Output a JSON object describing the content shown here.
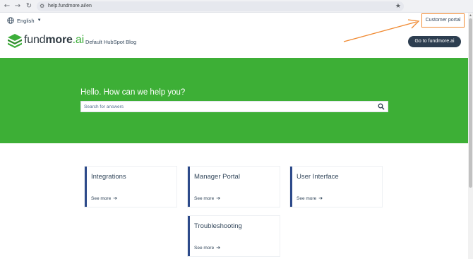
{
  "browser": {
    "url": "help.fundmore.ai/en",
    "back_icon": "←",
    "forward_icon": "→",
    "reload_icon": "↻",
    "site_info_icon": "⚙",
    "bookmark_icon": "★"
  },
  "header": {
    "language": "English",
    "customer_portal": "Customer portal",
    "logo_prefix": "fund",
    "logo_bold": "more",
    "logo_suffix": ".ai",
    "blog_link": "Default HubSpot Blog",
    "cta_button": "Go to fundmore.ai"
  },
  "hero": {
    "title": "Hello. How can we help you?",
    "search_placeholder": "Search for answers"
  },
  "categories": [
    {
      "title": "Integrations",
      "link": "See more"
    },
    {
      "title": "Manager Portal",
      "link": "See more"
    },
    {
      "title": "User Interface",
      "link": "See more"
    },
    {
      "title": "Troubleshooting",
      "link": "See more"
    }
  ],
  "colors": {
    "brand_green": "#3daf36",
    "navy": "#2d3e50",
    "card_accent": "#2d4a8a",
    "annotation_orange": "#f08a32"
  }
}
